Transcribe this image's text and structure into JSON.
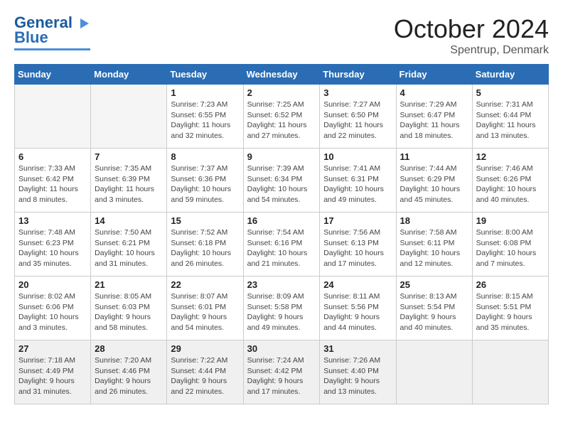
{
  "header": {
    "logo_line1": "General",
    "logo_line2": "Blue",
    "month": "October 2024",
    "location": "Spentrup, Denmark"
  },
  "weekdays": [
    "Sunday",
    "Monday",
    "Tuesday",
    "Wednesday",
    "Thursday",
    "Friday",
    "Saturday"
  ],
  "weeks": [
    [
      {
        "day": "",
        "empty": true
      },
      {
        "day": "",
        "empty": true
      },
      {
        "day": "1",
        "sunrise": "7:23 AM",
        "sunset": "6:55 PM",
        "daylight": "11 hours and 32 minutes."
      },
      {
        "day": "2",
        "sunrise": "7:25 AM",
        "sunset": "6:52 PM",
        "daylight": "11 hours and 27 minutes."
      },
      {
        "day": "3",
        "sunrise": "7:27 AM",
        "sunset": "6:50 PM",
        "daylight": "11 hours and 22 minutes."
      },
      {
        "day": "4",
        "sunrise": "7:29 AM",
        "sunset": "6:47 PM",
        "daylight": "11 hours and 18 minutes."
      },
      {
        "day": "5",
        "sunrise": "7:31 AM",
        "sunset": "6:44 PM",
        "daylight": "11 hours and 13 minutes."
      }
    ],
    [
      {
        "day": "6",
        "sunrise": "7:33 AM",
        "sunset": "6:42 PM",
        "daylight": "11 hours and 8 minutes."
      },
      {
        "day": "7",
        "sunrise": "7:35 AM",
        "sunset": "6:39 PM",
        "daylight": "11 hours and 3 minutes."
      },
      {
        "day": "8",
        "sunrise": "7:37 AM",
        "sunset": "6:36 PM",
        "daylight": "10 hours and 59 minutes."
      },
      {
        "day": "9",
        "sunrise": "7:39 AM",
        "sunset": "6:34 PM",
        "daylight": "10 hours and 54 minutes."
      },
      {
        "day": "10",
        "sunrise": "7:41 AM",
        "sunset": "6:31 PM",
        "daylight": "10 hours and 49 minutes."
      },
      {
        "day": "11",
        "sunrise": "7:44 AM",
        "sunset": "6:29 PM",
        "daylight": "10 hours and 45 minutes."
      },
      {
        "day": "12",
        "sunrise": "7:46 AM",
        "sunset": "6:26 PM",
        "daylight": "10 hours and 40 minutes."
      }
    ],
    [
      {
        "day": "13",
        "sunrise": "7:48 AM",
        "sunset": "6:23 PM",
        "daylight": "10 hours and 35 minutes."
      },
      {
        "day": "14",
        "sunrise": "7:50 AM",
        "sunset": "6:21 PM",
        "daylight": "10 hours and 31 minutes."
      },
      {
        "day": "15",
        "sunrise": "7:52 AM",
        "sunset": "6:18 PM",
        "daylight": "10 hours and 26 minutes."
      },
      {
        "day": "16",
        "sunrise": "7:54 AM",
        "sunset": "6:16 PM",
        "daylight": "10 hours and 21 minutes."
      },
      {
        "day": "17",
        "sunrise": "7:56 AM",
        "sunset": "6:13 PM",
        "daylight": "10 hours and 17 minutes."
      },
      {
        "day": "18",
        "sunrise": "7:58 AM",
        "sunset": "6:11 PM",
        "daylight": "10 hours and 12 minutes."
      },
      {
        "day": "19",
        "sunrise": "8:00 AM",
        "sunset": "6:08 PM",
        "daylight": "10 hours and 7 minutes."
      }
    ],
    [
      {
        "day": "20",
        "sunrise": "8:02 AM",
        "sunset": "6:06 PM",
        "daylight": "10 hours and 3 minutes."
      },
      {
        "day": "21",
        "sunrise": "8:05 AM",
        "sunset": "6:03 PM",
        "daylight": "9 hours and 58 minutes."
      },
      {
        "day": "22",
        "sunrise": "8:07 AM",
        "sunset": "6:01 PM",
        "daylight": "9 hours and 54 minutes."
      },
      {
        "day": "23",
        "sunrise": "8:09 AM",
        "sunset": "5:58 PM",
        "daylight": "9 hours and 49 minutes."
      },
      {
        "day": "24",
        "sunrise": "8:11 AM",
        "sunset": "5:56 PM",
        "daylight": "9 hours and 44 minutes."
      },
      {
        "day": "25",
        "sunrise": "8:13 AM",
        "sunset": "5:54 PM",
        "daylight": "9 hours and 40 minutes."
      },
      {
        "day": "26",
        "sunrise": "8:15 AM",
        "sunset": "5:51 PM",
        "daylight": "9 hours and 35 minutes."
      }
    ],
    [
      {
        "day": "27",
        "sunrise": "7:18 AM",
        "sunset": "4:49 PM",
        "daylight": "9 hours and 31 minutes."
      },
      {
        "day": "28",
        "sunrise": "7:20 AM",
        "sunset": "4:46 PM",
        "daylight": "9 hours and 26 minutes."
      },
      {
        "day": "29",
        "sunrise": "7:22 AM",
        "sunset": "4:44 PM",
        "daylight": "9 hours and 22 minutes."
      },
      {
        "day": "30",
        "sunrise": "7:24 AM",
        "sunset": "4:42 PM",
        "daylight": "9 hours and 17 minutes."
      },
      {
        "day": "31",
        "sunrise": "7:26 AM",
        "sunset": "4:40 PM",
        "daylight": "9 hours and 13 minutes."
      },
      {
        "day": "",
        "empty": true
      },
      {
        "day": "",
        "empty": true
      }
    ]
  ]
}
